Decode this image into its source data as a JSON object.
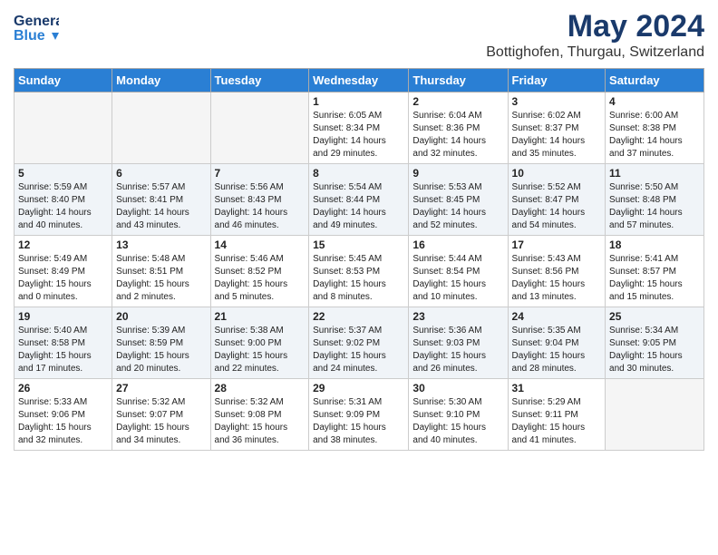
{
  "logo": {
    "general": "General",
    "blue": "Blue"
  },
  "title": "May 2024",
  "location": "Bottighofen, Thurgau, Switzerland",
  "weekdays": [
    "Sunday",
    "Monday",
    "Tuesday",
    "Wednesday",
    "Thursday",
    "Friday",
    "Saturday"
  ],
  "weeks": [
    [
      {
        "day": "",
        "info": ""
      },
      {
        "day": "",
        "info": ""
      },
      {
        "day": "",
        "info": ""
      },
      {
        "day": "1",
        "info": "Sunrise: 6:05 AM\nSunset: 8:34 PM\nDaylight: 14 hours\nand 29 minutes."
      },
      {
        "day": "2",
        "info": "Sunrise: 6:04 AM\nSunset: 8:36 PM\nDaylight: 14 hours\nand 32 minutes."
      },
      {
        "day": "3",
        "info": "Sunrise: 6:02 AM\nSunset: 8:37 PM\nDaylight: 14 hours\nand 35 minutes."
      },
      {
        "day": "4",
        "info": "Sunrise: 6:00 AM\nSunset: 8:38 PM\nDaylight: 14 hours\nand 37 minutes."
      }
    ],
    [
      {
        "day": "5",
        "info": "Sunrise: 5:59 AM\nSunset: 8:40 PM\nDaylight: 14 hours\nand 40 minutes."
      },
      {
        "day": "6",
        "info": "Sunrise: 5:57 AM\nSunset: 8:41 PM\nDaylight: 14 hours\nand 43 minutes."
      },
      {
        "day": "7",
        "info": "Sunrise: 5:56 AM\nSunset: 8:43 PM\nDaylight: 14 hours\nand 46 minutes."
      },
      {
        "day": "8",
        "info": "Sunrise: 5:54 AM\nSunset: 8:44 PM\nDaylight: 14 hours\nand 49 minutes."
      },
      {
        "day": "9",
        "info": "Sunrise: 5:53 AM\nSunset: 8:45 PM\nDaylight: 14 hours\nand 52 minutes."
      },
      {
        "day": "10",
        "info": "Sunrise: 5:52 AM\nSunset: 8:47 PM\nDaylight: 14 hours\nand 54 minutes."
      },
      {
        "day": "11",
        "info": "Sunrise: 5:50 AM\nSunset: 8:48 PM\nDaylight: 14 hours\nand 57 minutes."
      }
    ],
    [
      {
        "day": "12",
        "info": "Sunrise: 5:49 AM\nSunset: 8:49 PM\nDaylight: 15 hours\nand 0 minutes."
      },
      {
        "day": "13",
        "info": "Sunrise: 5:48 AM\nSunset: 8:51 PM\nDaylight: 15 hours\nand 2 minutes."
      },
      {
        "day": "14",
        "info": "Sunrise: 5:46 AM\nSunset: 8:52 PM\nDaylight: 15 hours\nand 5 minutes."
      },
      {
        "day": "15",
        "info": "Sunrise: 5:45 AM\nSunset: 8:53 PM\nDaylight: 15 hours\nand 8 minutes."
      },
      {
        "day": "16",
        "info": "Sunrise: 5:44 AM\nSunset: 8:54 PM\nDaylight: 15 hours\nand 10 minutes."
      },
      {
        "day": "17",
        "info": "Sunrise: 5:43 AM\nSunset: 8:56 PM\nDaylight: 15 hours\nand 13 minutes."
      },
      {
        "day": "18",
        "info": "Sunrise: 5:41 AM\nSunset: 8:57 PM\nDaylight: 15 hours\nand 15 minutes."
      }
    ],
    [
      {
        "day": "19",
        "info": "Sunrise: 5:40 AM\nSunset: 8:58 PM\nDaylight: 15 hours\nand 17 minutes."
      },
      {
        "day": "20",
        "info": "Sunrise: 5:39 AM\nSunset: 8:59 PM\nDaylight: 15 hours\nand 20 minutes."
      },
      {
        "day": "21",
        "info": "Sunrise: 5:38 AM\nSunset: 9:00 PM\nDaylight: 15 hours\nand 22 minutes."
      },
      {
        "day": "22",
        "info": "Sunrise: 5:37 AM\nSunset: 9:02 PM\nDaylight: 15 hours\nand 24 minutes."
      },
      {
        "day": "23",
        "info": "Sunrise: 5:36 AM\nSunset: 9:03 PM\nDaylight: 15 hours\nand 26 minutes."
      },
      {
        "day": "24",
        "info": "Sunrise: 5:35 AM\nSunset: 9:04 PM\nDaylight: 15 hours\nand 28 minutes."
      },
      {
        "day": "25",
        "info": "Sunrise: 5:34 AM\nSunset: 9:05 PM\nDaylight: 15 hours\nand 30 minutes."
      }
    ],
    [
      {
        "day": "26",
        "info": "Sunrise: 5:33 AM\nSunset: 9:06 PM\nDaylight: 15 hours\nand 32 minutes."
      },
      {
        "day": "27",
        "info": "Sunrise: 5:32 AM\nSunset: 9:07 PM\nDaylight: 15 hours\nand 34 minutes."
      },
      {
        "day": "28",
        "info": "Sunrise: 5:32 AM\nSunset: 9:08 PM\nDaylight: 15 hours\nand 36 minutes."
      },
      {
        "day": "29",
        "info": "Sunrise: 5:31 AM\nSunset: 9:09 PM\nDaylight: 15 hours\nand 38 minutes."
      },
      {
        "day": "30",
        "info": "Sunrise: 5:30 AM\nSunset: 9:10 PM\nDaylight: 15 hours\nand 40 minutes."
      },
      {
        "day": "31",
        "info": "Sunrise: 5:29 AM\nSunset: 9:11 PM\nDaylight: 15 hours\nand 41 minutes."
      },
      {
        "day": "",
        "info": ""
      }
    ]
  ]
}
